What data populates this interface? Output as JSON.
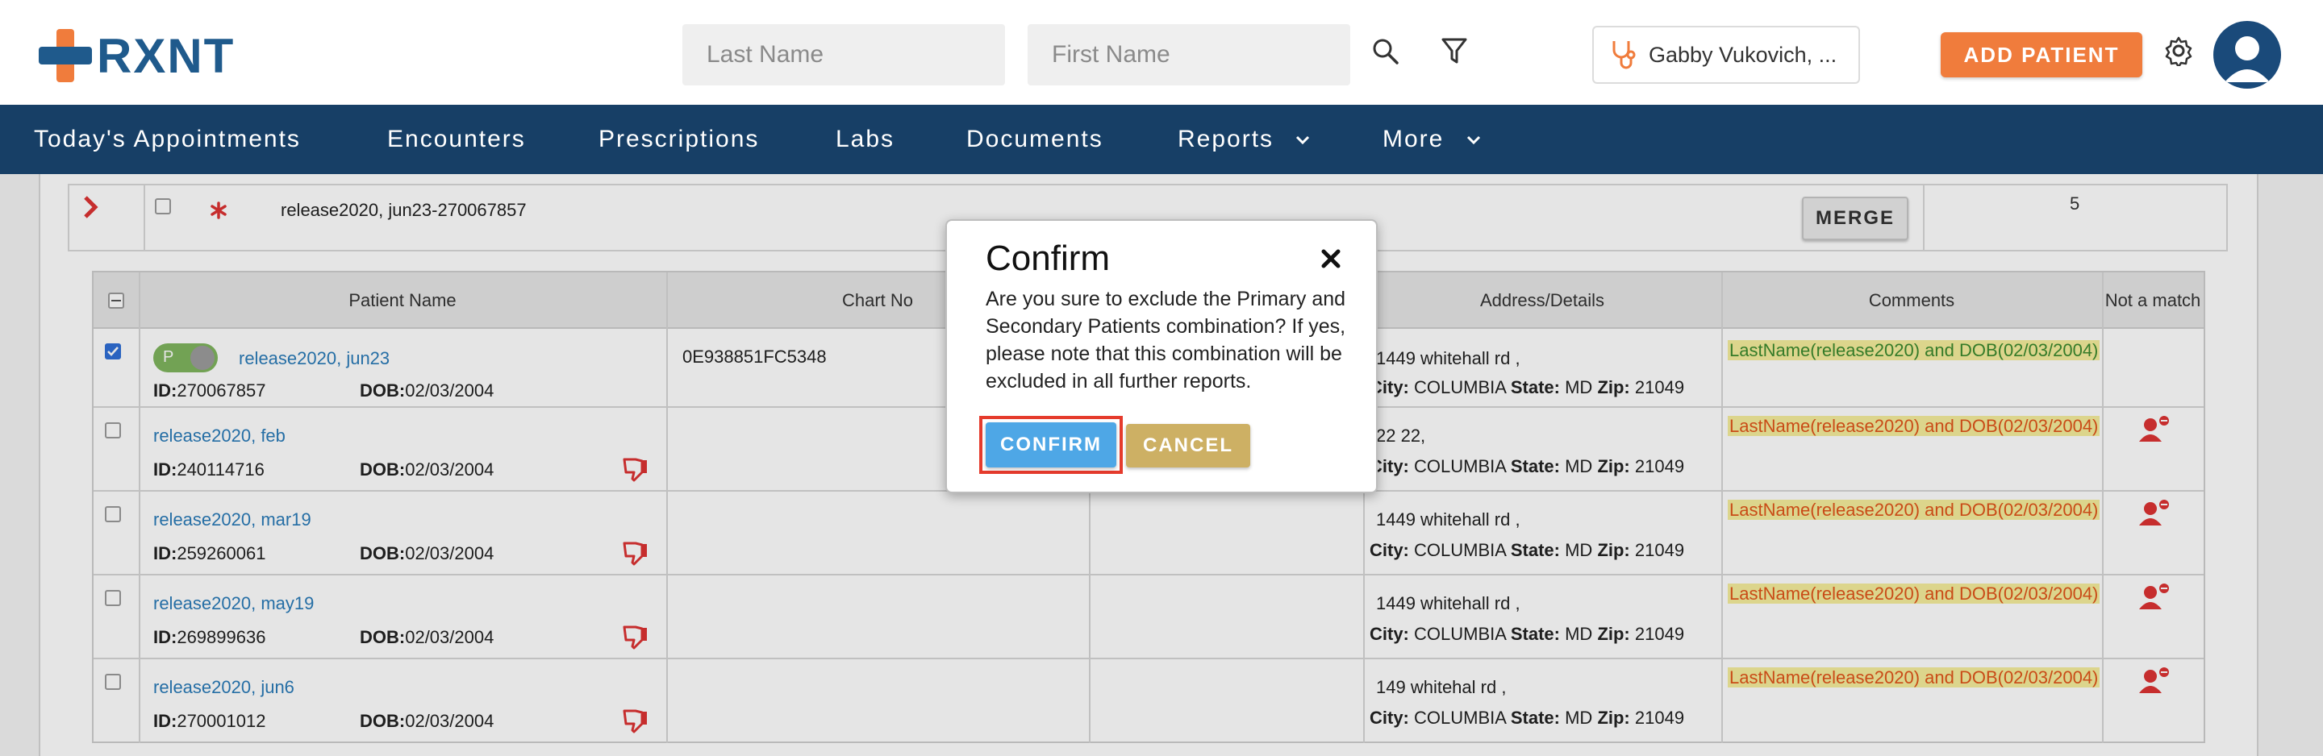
{
  "header": {
    "logo_text": "RXNT",
    "last_name_placeholder": "Last Name",
    "first_name_placeholder": "First Name",
    "provider_name": "Gabby Vukovich, ...",
    "add_patient_label": "ADD PATIENT",
    "icons": [
      "rxnt-cross-logo",
      "search-icon",
      "filter-icon",
      "stethoscope-icon",
      "gear-icon",
      "user-avatar-icon"
    ]
  },
  "nav": {
    "items": [
      {
        "label": "Today's Appointments"
      },
      {
        "label": "Encounters"
      },
      {
        "label": "Prescriptions"
      },
      {
        "label": "Labs"
      },
      {
        "label": "Documents"
      },
      {
        "label": "Reports"
      },
      {
        "label": "More"
      }
    ]
  },
  "group": {
    "name": "release2020, jun23-270067857",
    "merge_label": "MERGE",
    "count": "5"
  },
  "table": {
    "headers": {
      "patient_name": "Patient Name",
      "chart_no": "Chart No",
      "address": "Address/Details",
      "comments": "Comments",
      "not_match": "Not a match"
    },
    "id_label": "ID:",
    "dob_label": "DOB:",
    "city_label": "City:",
    "state_label": "State:",
    "zip_label": "Zip:",
    "primary_badge": "P",
    "rows": [
      {
        "name": "release2020, jun23",
        "id": "270067857",
        "dob": "02/03/2004",
        "chart": "0E938851FC5348",
        "addr": "1449 whitehall rd ,",
        "city": "COLUMBIA",
        "state": "MD",
        "zip": "21049",
        "comment": "LastName(release2020) and DOB(02/03/2004)"
      },
      {
        "name": "release2020, feb",
        "id": "240114716",
        "dob": "02/03/2004",
        "chart": "",
        "addr": "22 22,",
        "city": "COLUMBIA",
        "state": "MD",
        "zip": "21049",
        "comment": "LastName(release2020) and DOB(02/03/2004)"
      },
      {
        "name": "release2020, mar19",
        "id": "259260061",
        "dob": "02/03/2004",
        "chart": "",
        "addr": "1449 whitehall rd ,",
        "city": "COLUMBIA",
        "state": "MD",
        "zip": "21049",
        "comment": "LastName(release2020) and DOB(02/03/2004)"
      },
      {
        "name": "release2020, may19",
        "id": "269899636",
        "dob": "02/03/2004",
        "chart": "",
        "addr": "1449 whitehall rd ,",
        "city": "COLUMBIA",
        "state": "MD",
        "zip": "21049",
        "comment": "LastName(release2020) and DOB(02/03/2004)"
      },
      {
        "name": "release2020, jun6",
        "id": "270001012",
        "dob": "02/03/2004",
        "chart": "",
        "addr": "149 whitehal rd ,",
        "city": "COLUMBIA",
        "state": "MD",
        "zip": "21049",
        "comment": "LastName(release2020) and DOB(02/03/2004)"
      }
    ]
  },
  "modal": {
    "title": "Confirm",
    "body": "Are you sure to exclude the Primary and Secondary Patients combination? If yes, please note that this combination will be excluded in all further reports.",
    "confirm_label": "CONFIRM",
    "cancel_label": "CANCEL"
  },
  "colors": {
    "nav_bg": "#173f66",
    "accent_orange": "#f07c3c",
    "confirm_blue": "#4ea7e6",
    "cancel_gold": "#cdb064",
    "link_blue": "#2a7bb8"
  }
}
